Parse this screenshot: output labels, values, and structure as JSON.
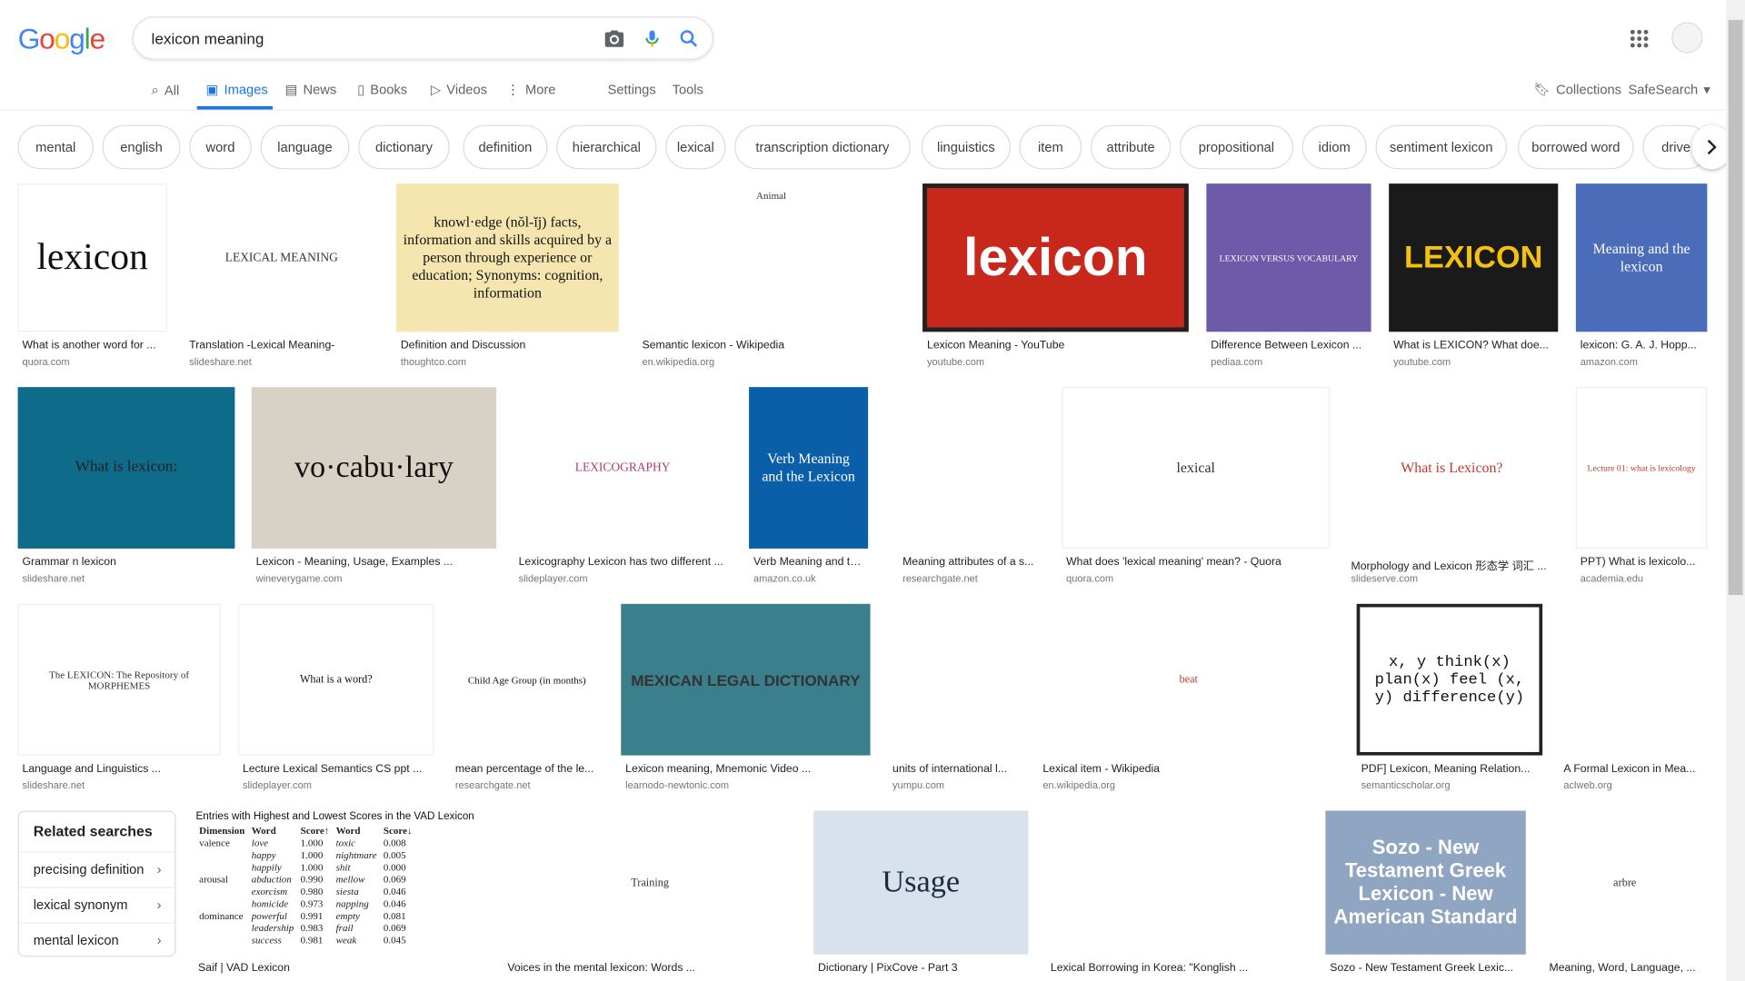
{
  "logo": {
    "letters": [
      "G",
      "o",
      "o",
      "g",
      "l",
      "e"
    ],
    "colors": [
      "#4285f4",
      "#ea4335",
      "#fbbc05",
      "#4285f4",
      "#34a853",
      "#ea4335"
    ]
  },
  "search": {
    "query": "lexicon meaning"
  },
  "tabs": [
    {
      "label": "All",
      "icon": "search-icon"
    },
    {
      "label": "Images",
      "icon": "image-icon"
    },
    {
      "label": "News",
      "icon": "news-icon"
    },
    {
      "label": "Books",
      "icon": "book-icon"
    },
    {
      "label": "Videos",
      "icon": "play-icon"
    },
    {
      "label": "More",
      "icon": "more-vert-icon"
    },
    {
      "label": "Settings"
    },
    {
      "label": "Tools"
    }
  ],
  "right_tools": {
    "collections": "Collections",
    "safesearch": "SafeSearch"
  },
  "chips": [
    "mental",
    "english",
    "word",
    "language",
    "dictionary",
    "definition",
    "hierarchical",
    "lexical",
    "transcription dictionary",
    "linguistics",
    "item",
    "attribute",
    "propositional",
    "idiom",
    "sentiment lexicon",
    "borrowed word",
    "drive"
  ],
  "rows": [
    [
      {
        "caption": "What is another word for ...",
        "source": "quora.com",
        "text": "lexicon"
      },
      {
        "caption": "Translation -Lexical Meaning-",
        "source": "slideshare.net",
        "text": "LEXICAL MEANING"
      },
      {
        "caption": "Definition and Discussion",
        "source": "thoughtco.com",
        "text": "knowl·edge (nŏl-ĭj) facts, information and skills acquired by a person through experience or education; Synonyms: cognition, information"
      },
      {
        "caption": "Semantic lexicon - Wikipedia",
        "source": "en.wikipedia.org",
        "text": "Animal"
      },
      {
        "caption": "Lexicon Meaning - YouTube",
        "source": "youtube.com",
        "text": "lexicon"
      },
      {
        "caption": "Difference Between Lexicon ...",
        "source": "pediaa.com",
        "text": "LEXICON VERSUS VOCABULARY"
      },
      {
        "caption": "What is LEXICON? What doe...",
        "source": "youtube.com",
        "text": "LEXICON"
      },
      {
        "caption": "lexicon: G. A. J. Hopp...",
        "source": "amazon.com",
        "text": "Meaning and the lexicon"
      }
    ],
    [
      {
        "caption": "Grammar n lexicon",
        "source": "slideshare.net",
        "text": "What is lexicon:"
      },
      {
        "caption": "Lexicon - Meaning, Usage, Examples ...",
        "source": "wineverygame.com",
        "text": "vo·cabu·lary"
      },
      {
        "caption": "Lexicography Lexicon has two different ...",
        "source": "slideplayer.com",
        "text": "LEXICOGRAPHY"
      },
      {
        "caption": "Verb Meaning and the ...",
        "source": "amazon.co.uk",
        "text": "Verb Meaning and the Lexicon"
      },
      {
        "caption": "Meaning attributes of a s...",
        "source": "researchgate.net",
        "text": ""
      },
      {
        "caption": "What does 'lexical meaning' mean? - Quora",
        "source": "quora.com",
        "text": "lexical"
      },
      {
        "caption": "Morphology and Lexicon 形态学 词汇 ...",
        "source": "slideserve.com",
        "text": "What is Lexicon?"
      },
      {
        "caption": "PPT) What is lexicolo...",
        "source": "academia.edu",
        "text": "Lecture 01: what is lexicology"
      }
    ],
    [
      {
        "caption": "Language and Linguistics ...",
        "source": "slideshare.net",
        "text": "The LEXICON: The Repository of MORPHEMES"
      },
      {
        "caption": "Lecture Lexical Semantics CS ppt ...",
        "source": "slideplayer.com",
        "text": "What is a word?"
      },
      {
        "caption": "mean percentage of the le...",
        "source": "researchgate.net",
        "text": "Child Age Group (in months)"
      },
      {
        "caption": "Lexicon meaning, Mnemonic Video ...",
        "source": "learnodo-newtonic.com",
        "text": "MEXICAN LEGAL DICTIONARY"
      },
      {
        "caption": "units of international l...",
        "source": "yumpu.com",
        "text": ""
      },
      {
        "caption": "Lexical item - Wikipedia",
        "source": "en.wikipedia.org",
        "text": "beat"
      },
      {
        "caption": "PDF] Lexicon, Meaning Relation...",
        "source": "semanticscholar.org",
        "text": "x, y think(x) plan(x) feel (x, y) difference(y)"
      },
      {
        "caption": "A Formal Lexicon in Mea...",
        "source": "aclweb.org",
        "text": ""
      }
    ],
    [
      {
        "caption": "Saif | VAD Lexicon",
        "source": "",
        "text": "Entries with Highest and Lowest Scores in the VAD Lexicon"
      },
      {
        "caption": "Voices in the mental lexicon: Words ...",
        "source": "",
        "text": "Training"
      },
      {
        "caption": "Dictionary | PixCove - Part 3",
        "source": "",
        "text": "Usage"
      },
      {
        "caption": "Lexical Borrowing in Korea: \"Konglish ...",
        "source": "",
        "text": ""
      },
      {
        "caption": "Sozo - New Testament Greek Lexic...",
        "source": "",
        "text": "Sozo - New Testament Greek Lexicon - New American Standard"
      },
      {
        "caption": "Meaning, Word, Language, ...",
        "source": "",
        "text": "arbre"
      }
    ]
  ],
  "vad_table": {
    "headers": [
      "Dimension",
      "Word",
      "Score↑",
      "Word",
      "Score↓"
    ],
    "rows": [
      [
        "valence",
        "love",
        "1.000",
        "toxic",
        "0.008"
      ],
      [
        "",
        "happy",
        "1.000",
        "nightmare",
        "0.005"
      ],
      [
        "",
        "happily",
        "1.000",
        "shit",
        "0.000"
      ],
      [
        "arousal",
        "abduction",
        "0.990",
        "mellow",
        "0.069"
      ],
      [
        "",
        "exorcism",
        "0.980",
        "siesta",
        "0.046"
      ],
      [
        "",
        "homicide",
        "0.973",
        "napping",
        "0.046"
      ],
      [
        "dominance",
        "powerful",
        "0.991",
        "empty",
        "0.081"
      ],
      [
        "",
        "leadership",
        "0.983",
        "frail",
        "0.069"
      ],
      [
        "",
        "success",
        "0.981",
        "weak",
        "0.045"
      ]
    ]
  },
  "related": {
    "heading": "Related searches",
    "items": [
      "precising definition",
      "lexical synonym",
      "mental lexicon"
    ]
  }
}
